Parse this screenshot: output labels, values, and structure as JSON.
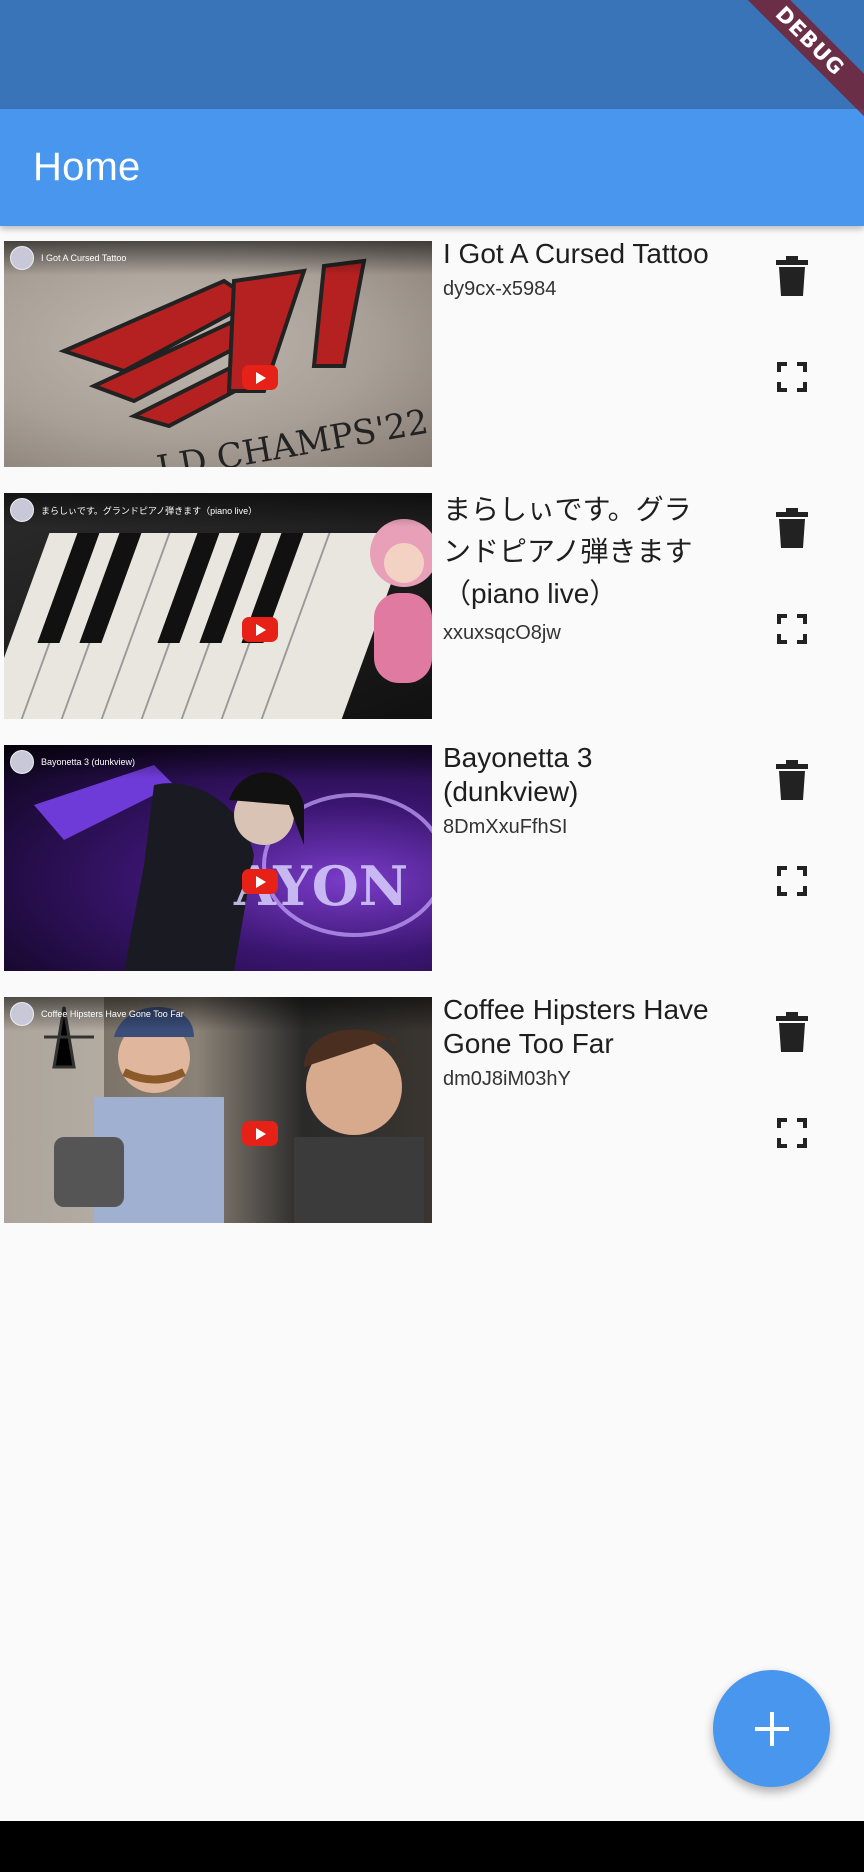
{
  "status_bar": {
    "debug_label": "DEBUG"
  },
  "app_bar": {
    "title": "Home"
  },
  "videos": [
    {
      "title": "I Got A Cursed Tattoo",
      "video_id": "dy9cx-x5984",
      "thumbnail_caption": "I Got A Cursed Tattoo"
    },
    {
      "title": "まらしぃです。グランドピアノ弾きます（piano live）",
      "video_id": "xxuxsqcO8jw",
      "thumbnail_caption": "まらしぃです。グランドピアノ弾きます（piano live）"
    },
    {
      "title": "Bayonetta 3 (dunkview)",
      "video_id": "8DmXxuFfhSI",
      "thumbnail_caption": "Bayonetta 3 (dunkview)"
    },
    {
      "title": "Coffee Hipsters Have Gone Too Far",
      "video_id": "dm0J8iM03hY",
      "thumbnail_caption": "Coffee Hipsters Have Gone Too Far"
    }
  ],
  "icons": {
    "delete": "trash-icon",
    "fullscreen": "fullscreen-icon",
    "add": "plus-icon"
  },
  "colors": {
    "status_bar": "#3a74b8",
    "app_bar": "#4896ed",
    "fab": "#4896ed",
    "background": "#fafafa",
    "youtube_red": "#e62117"
  }
}
